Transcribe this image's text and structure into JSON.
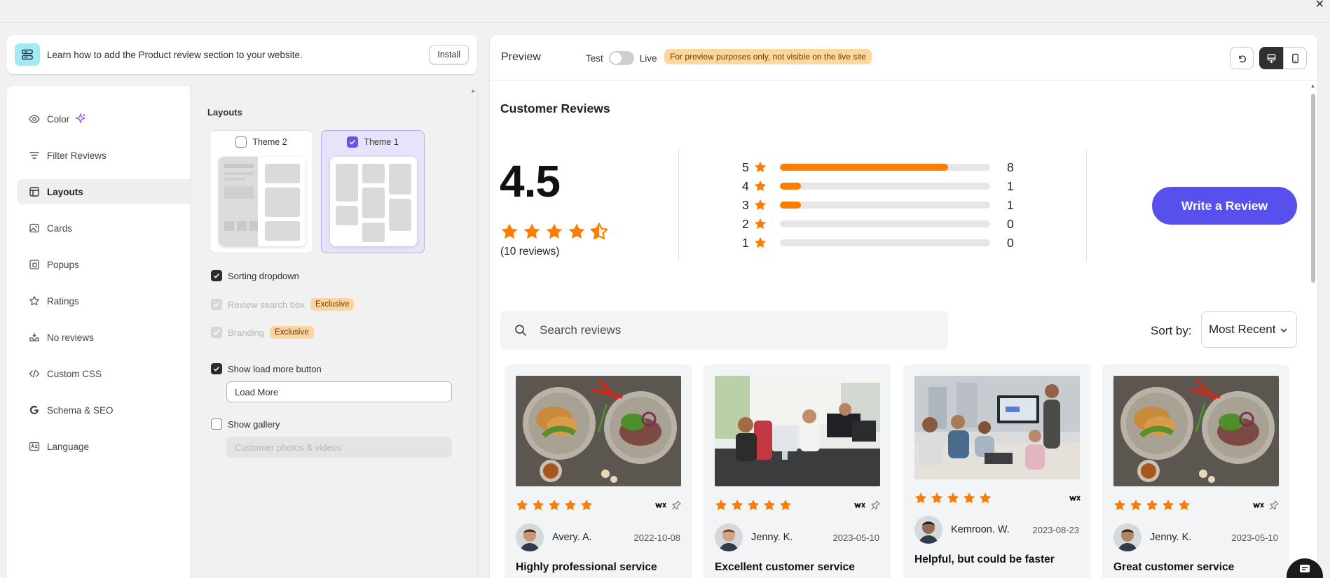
{
  "window": {
    "close_icon": "close-icon"
  },
  "banner": {
    "icon": "layout-sections-icon",
    "text": "Learn how to add the Product review section to your website.",
    "install_label": "Install"
  },
  "menu": {
    "items": [
      {
        "label": "Color",
        "icon": "eye-icon",
        "badge_icon": "sparkle-icon"
      },
      {
        "label": "Filter Reviews",
        "icon": "filter-lines-icon"
      },
      {
        "label": "Layouts",
        "icon": "layout-icon",
        "active": true
      },
      {
        "label": "Cards",
        "icon": "image-card-icon"
      },
      {
        "label": "Popups",
        "icon": "popup-icon"
      },
      {
        "label": "Ratings",
        "icon": "star-icon"
      },
      {
        "label": "No reviews",
        "icon": "inbox-icon"
      },
      {
        "label": "Custom CSS",
        "icon": "code-icon"
      },
      {
        "label": "Schema & SEO",
        "icon": "google-icon"
      },
      {
        "label": "Language",
        "icon": "language-icon"
      }
    ]
  },
  "layouts": {
    "title": "Layouts",
    "themes": [
      {
        "label": "Theme 2",
        "checked": false
      },
      {
        "label": "Theme 1",
        "checked": true
      }
    ],
    "options": {
      "sorting": "Sorting dropdown",
      "search": "Review search box",
      "branding": "Branding",
      "exclusive": "Exclusive",
      "load_more": "Show load more button",
      "load_more_value": "Load More",
      "gallery": "Show gallery",
      "gallery_placeholder": "Customer photos & videos"
    }
  },
  "preview": {
    "title": "Preview",
    "mode_test": "Test",
    "mode_live": "Live",
    "notice": "For preview purposes only, not visible on the live site",
    "controls": [
      "undo-icon",
      "desktop-icon",
      "mobile-icon"
    ]
  },
  "reviews_widget": {
    "heading": "Customer Reviews",
    "average": "4.5",
    "average_value": 4.5,
    "count_text": "(10 reviews)",
    "distribution": [
      {
        "stars": "5",
        "count": "8",
        "fraction": 0.8
      },
      {
        "stars": "4",
        "count": "1",
        "fraction": 0.1
      },
      {
        "stars": "3",
        "count": "1",
        "fraction": 0.1
      },
      {
        "stars": "2",
        "count": "0",
        "fraction": 0
      },
      {
        "stars": "1",
        "count": "0",
        "fraction": 0
      }
    ],
    "write_button": "Write a Review",
    "search_placeholder": "Search reviews",
    "sort_label": "Sort by:",
    "sort_value": "Most Recent",
    "star_color": "#fb7d04",
    "button_color": "#5850ec"
  },
  "review_cards": [
    {
      "name": "Avery. A.",
      "date": "2022-10-08",
      "title": "Highly professional service",
      "rating": 5,
      "image": "food-bowls",
      "pin": true
    },
    {
      "name": "Jenny. K.",
      "date": "2023-05-10",
      "title": "Excellent customer service",
      "rating": 5,
      "image": "office-desks",
      "pin": true
    },
    {
      "name": "Kemroon. W.",
      "date": "2023-08-23",
      "title": "Helpful, but could be faster",
      "rating": 5,
      "image": "meeting-room",
      "pin": false
    },
    {
      "name": "Jenny. K.",
      "date": "2023-05-10",
      "title": "Great customer service",
      "rating": 5,
      "image": "food-bowls",
      "pin": true
    }
  ]
}
